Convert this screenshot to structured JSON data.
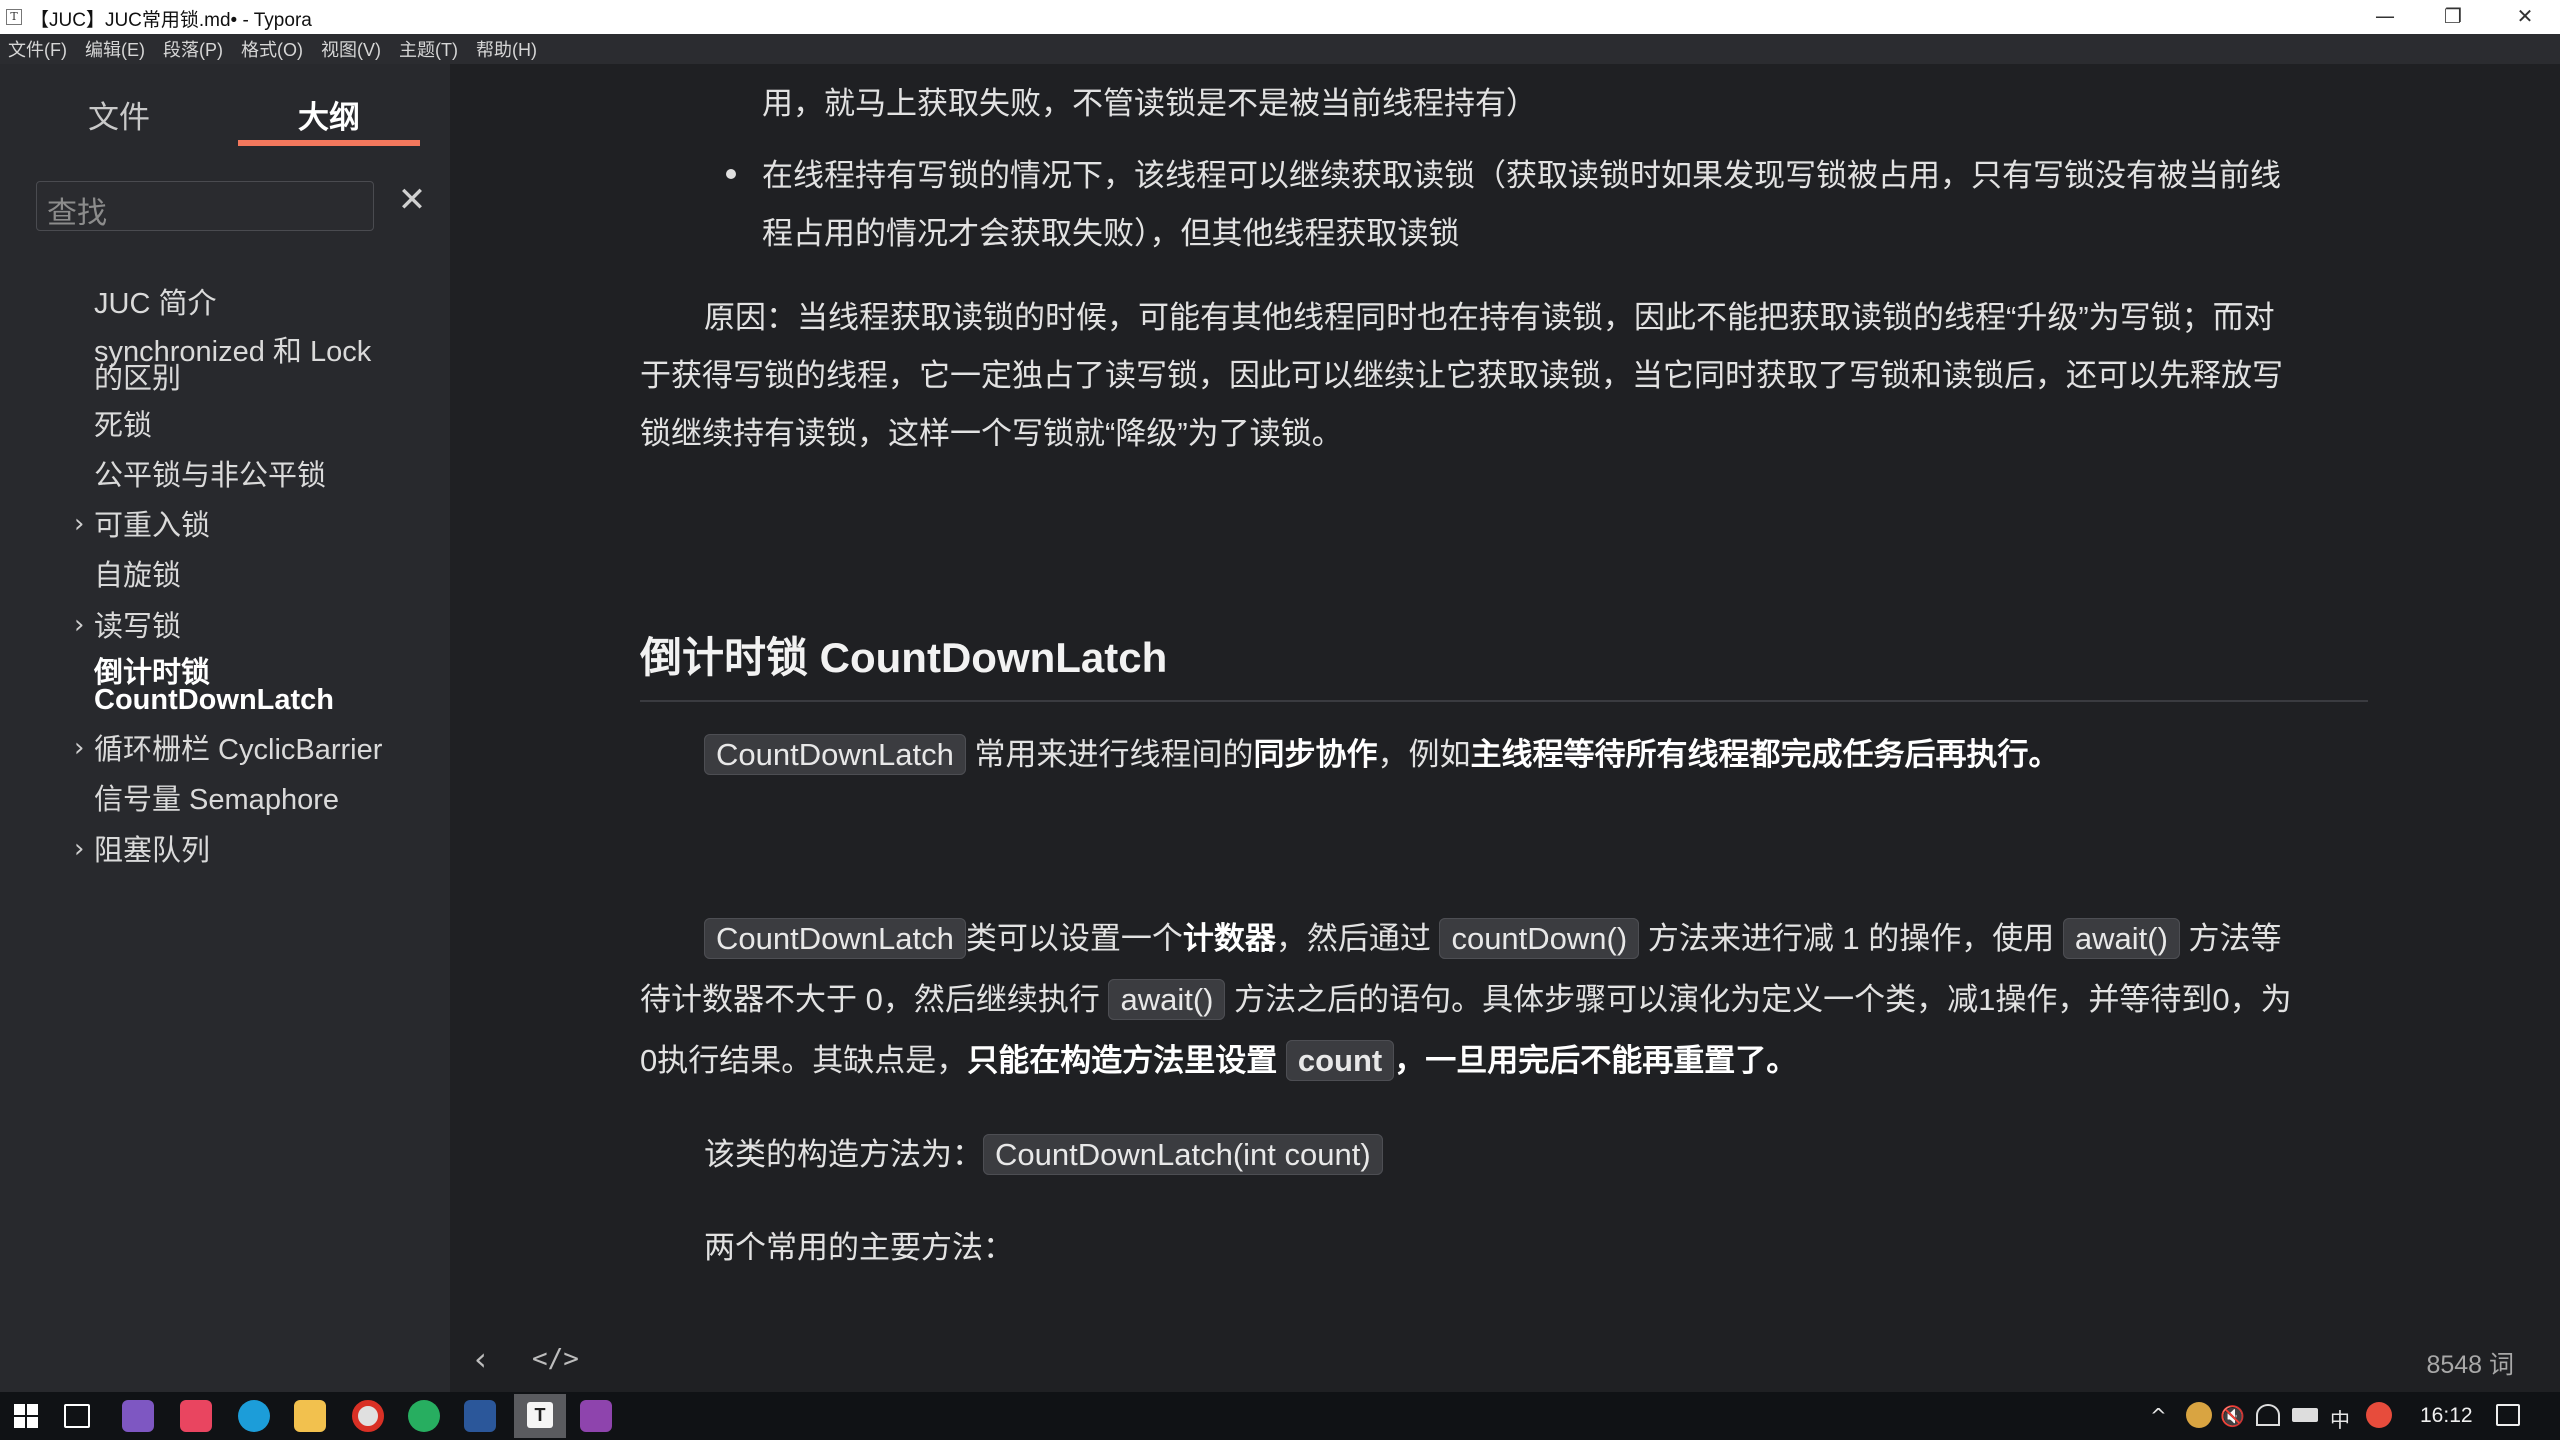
{
  "window": {
    "app_icon": "T",
    "title": "【JUC】JUC常用锁.md• - Typora",
    "minimize_glyph": "—",
    "maximize_glyph": "❐",
    "close_glyph": "✕"
  },
  "menu": [
    "文件(F)",
    "编辑(E)",
    "段落(P)",
    "格式(O)",
    "视图(V)",
    "主题(T)",
    "帮助(H)"
  ],
  "sidebar": {
    "tabs": [
      "文件",
      "大纲"
    ],
    "active_tab": "大纲",
    "accent_color": "#f3785d",
    "search_placeholder": "查找",
    "search_clear_glyph": "✕",
    "expander_glyph": "›",
    "outline": [
      {
        "label": "JUC 简介",
        "expandable": false
      },
      {
        "label_lines": [
          "synchronized 和 Lock",
          "的区别"
        ],
        "expandable": false
      },
      {
        "label": "死锁",
        "expandable": false
      },
      {
        "label": "公平锁与非公平锁",
        "expandable": false
      },
      {
        "label": "可重入锁",
        "expandable": true
      },
      {
        "label": "自旋锁",
        "expandable": false
      },
      {
        "label": "读写锁",
        "expandable": true
      },
      {
        "label_lines": [
          "倒计时锁",
          "CountDownLatch"
        ],
        "expandable": false,
        "active": true
      },
      {
        "label": "循环栅栏 CyclicBarrier",
        "expandable": true
      },
      {
        "label": "信号量 Semaphore",
        "expandable": false
      },
      {
        "label": "阻塞队列",
        "expandable": true
      }
    ]
  },
  "content": {
    "top_fragment": "用，就马上获取失败，不管读锁是不是被当前线程持有）",
    "bullet_line1": "在线程持有写锁的情况下，该线程可以继续获取读锁（获取读锁时如果发现写锁被占用，只有写锁没有被当前线",
    "bullet_line2": "程占用的情况才会获取失败），但其他线程获取读锁",
    "reason_line1": "原因：当线程获取读锁的时候，可能有其他线程同时也在持有读锁，因此不能把获取读锁的线程“升级”为写锁；而对",
    "reason_line2": "于获得写锁的线程，它一定独占了读写锁，因此可以继续让它获取读锁，当它同时获取了写锁和读锁后，还可以先释放写",
    "reason_line3": "锁继续持有读锁，这样一个写锁就“降级”为了读锁。",
    "heading": "倒计时锁 CountDownLatch",
    "p1": {
      "code": "CountDownLatch",
      "text1": " 常用来进行线程间的",
      "bold1": "同步协作",
      "text2": "，例如",
      "bold2": "主线程等待所有线程都完成任务后再执行。"
    },
    "p2_line1": {
      "code1": "CountDownLatch",
      "text1": "类可以设置一个",
      "bold1": "计数器",
      "text2": "，然后通过 ",
      "code2": "countDown()",
      "text3": " 方法来进行减 1 的操作，使用 ",
      "code3": "await()",
      "text4": " 方法等"
    },
    "p2_line2": {
      "text1": "待计数器不大于 0，然后继续执行 ",
      "code1": "await()",
      "text2": " 方法之后的语句。具体步骤可以演化为定义一个类，减1操作，并等待到0，为"
    },
    "p2_line3": {
      "text1": "0执行结果。其缺点是，",
      "bold1": "只能在构造方法里设置 ",
      "code1": "count",
      "bold2": "，一旦用完后不能再重置了。"
    },
    "p3": {
      "text": "该类的构造方法为：",
      "code": "CountDownLatch(int count)"
    },
    "p4": "两个常用的主要方法："
  },
  "footer": {
    "back_glyph": "‹",
    "source_glyph": "</>",
    "word_count": "8548 词"
  },
  "taskbar": {
    "icons": [
      "windows-start-icon",
      "task-view-icon",
      "visual-studio-icon",
      "jetbrains-icon",
      "edge-icon",
      "file-explorer-icon",
      "chrome-icon",
      "wechat-icon",
      "word-icon",
      "typora-icon",
      "obs-icon"
    ],
    "tray": {
      "chevron": "^",
      "volume": "🔇",
      "ime": "中",
      "clock": "16:12"
    }
  }
}
